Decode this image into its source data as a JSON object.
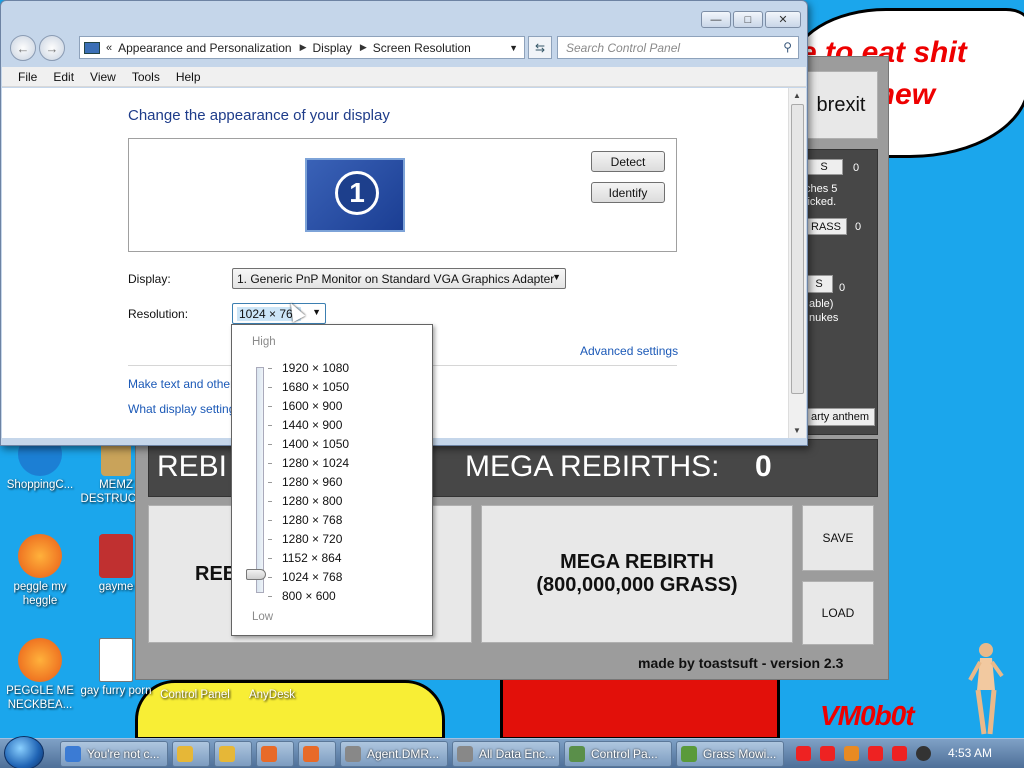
{
  "window": {
    "breadcrumbs": [
      "Appearance and Personalization",
      "Display",
      "Screen Resolution"
    ],
    "search_placeholder": "Search Control Panel",
    "menu": [
      "File",
      "Edit",
      "View",
      "Tools",
      "Help"
    ],
    "heading": "Change the appearance of your display",
    "monitor_number": "1",
    "detect_label": "Detect",
    "identify_label": "Identify",
    "display_label": "Display:",
    "display_value": "1. Generic PnP Monitor on Standard VGA Graphics Adapter",
    "resolution_label": "Resolution:",
    "resolution_value": "1024 × 768",
    "advanced_link": "Advanced settings",
    "text_link": "Make text and other",
    "settings_link": "What display setting"
  },
  "resolution_dropdown": {
    "high_label": "High",
    "low_label": "Low",
    "options": [
      "1920 × 1080",
      "1680 × 1050",
      "1600 × 900",
      "1440 × 900",
      "1400 × 1050",
      "1280 × 1024",
      "1280 × 960",
      "1280 × 800",
      "1280 × 768",
      "1280 × 720",
      "1152 × 864",
      "1024 × 768",
      "800 × 600"
    ],
    "selected": "1024 × 768"
  },
  "game": {
    "brexit_label": "brexit",
    "right_labels": {
      "btn1": "S",
      "count1": "0",
      "desc1": "ches 5",
      "desc1b": "licked.",
      "btn2": "RASS",
      "count2": "0",
      "btn3": "S",
      "count3": "0",
      "desc3": "able)",
      "desc3b": "nukes",
      "anthem": "arty anthem"
    },
    "rebirth_stat": "REBI",
    "mega_rebirths_label": "MEGA REBIRTHS:",
    "mega_rebirths_value": "0",
    "rebirth_btn": "REB",
    "mega_rebirth_btn_line1": "MEGA REBIRTH",
    "mega_rebirth_btn_line2": "(800,000,000 GRASS)",
    "save_label": "SAVE",
    "load_label": "LOAD",
    "footer": "made by toastsuft - version 2.3"
  },
  "wallpaper": {
    "bubble_line1": "e to eat shit",
    "bubble_line2": "chew",
    "signature": "VM0b0t"
  },
  "desktop_icons": [
    {
      "label": "ShoppingC...",
      "color": "#1c7fd4"
    },
    {
      "label": "MEMZ DESTRUCT...",
      "color": "#b0b0b0"
    },
    {
      "label": "peggle my heggle",
      "color": "#e85a17"
    },
    {
      "label": "gayme",
      "color": "#c03030"
    },
    {
      "label": "PEGGLE ME NECKBEA...",
      "color": "#e85a17"
    },
    {
      "label": "gay furry porn",
      "color": "#3b5fc0"
    },
    {
      "label": "Control Panel",
      "color": "#3c8f3c"
    },
    {
      "label": "AnyDesk",
      "color": "#d33"
    }
  ],
  "taskbar": {
    "items": [
      {
        "label": "You're not c...",
        "color": "#3b7bd4"
      },
      {
        "label": "",
        "color": "#e6b737"
      },
      {
        "label": "",
        "color": "#e6b737"
      },
      {
        "label": "",
        "color": "#e86a28"
      },
      {
        "label": "",
        "color": "#e86a28"
      },
      {
        "label": "Agent.DMR...",
        "color": "#888"
      },
      {
        "label": "All Data Enc...",
        "color": "#888"
      },
      {
        "label": "Control Pa...",
        "color": "#5a8f4a"
      },
      {
        "label": "Grass Mowi...",
        "color": "#5a9a3a"
      }
    ],
    "clock": "4:53 AM"
  }
}
